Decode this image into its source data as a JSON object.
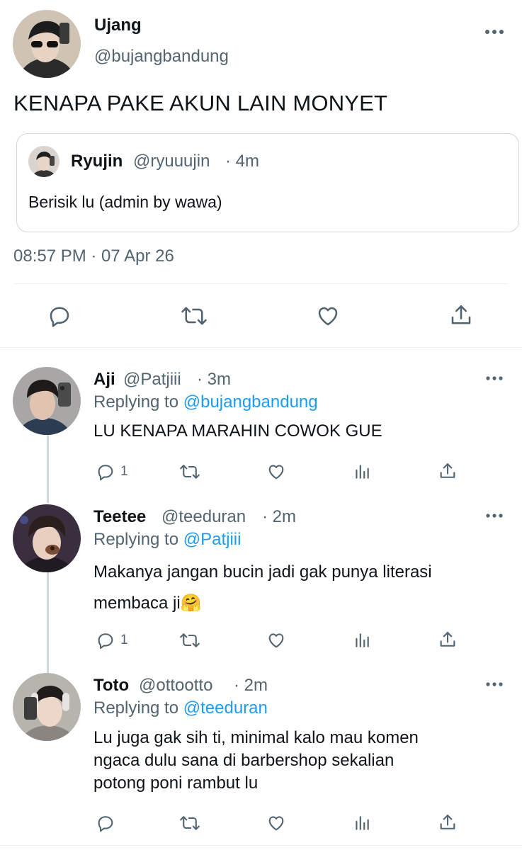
{
  "main_tweet": {
    "display_name": "Ujang",
    "handle": "@bujangbandung",
    "text": "KENAPA PAKE AKUN LAIN MONYET",
    "quote": {
      "display_name": "Ryujin",
      "handle": "@ryuuujin",
      "time": "· 4m",
      "text": "Berisik lu (admin by wawa)"
    },
    "timestamp": "08:57 PM · 07 Apr 26",
    "actions": [
      "reply-icon",
      "retweet-icon",
      "like-icon",
      "share-icon"
    ]
  },
  "replies": [
    {
      "display_name": "Aji",
      "handle": "@Patjiii",
      "time": "· 3m",
      "replying_prefix": "Replying to",
      "replying_to": "@bujangbandung",
      "text_lines": [
        "LU KENAPA MARAHIN COWOK GUE"
      ],
      "reply_count": "1"
    },
    {
      "display_name": "Teetee",
      "handle": "@teeduran",
      "time": "· 2m",
      "replying_prefix": "Replying to",
      "replying_to": "@Patjiii",
      "text_lines": [
        "Makanya jangan bucin jadi gak punya literasi",
        "membaca ji"
      ],
      "emoji": "🤗",
      "reply_count": "1"
    },
    {
      "display_name": "Toto",
      "handle": "@ottootto",
      "time": "· 2m",
      "replying_prefix": "Replying to",
      "replying_to": "@teeduran",
      "text_lines": [
        "Lu juga gak sih ti, minimal kalo mau komen",
        "ngaca dulu sana di barbershop sekalian",
        "potong poni rambut lu"
      ],
      "reply_count": ""
    }
  ],
  "colors": {
    "link": "#1d9bf0",
    "muted": "#536471",
    "text": "#0f1419",
    "border": "#cfd9de"
  }
}
